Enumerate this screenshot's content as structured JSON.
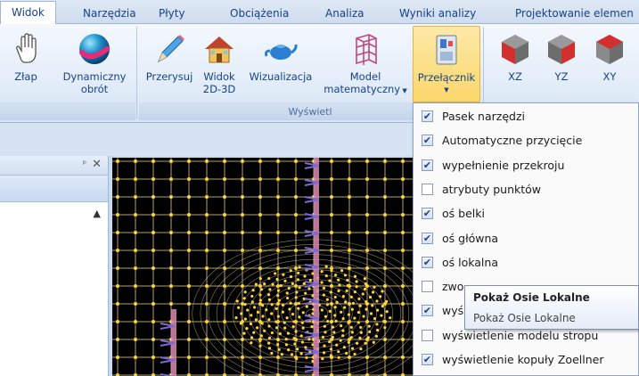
{
  "tabs": [
    {
      "label": "Widok",
      "active": true
    },
    {
      "label": "Narzędzia"
    },
    {
      "label": "Płyty"
    },
    {
      "label": "Obciążenia"
    },
    {
      "label": "Analiza"
    },
    {
      "label": "Wyniki analizy"
    },
    {
      "label": "Projektowanie elemen"
    }
  ],
  "ribbon": {
    "buttons": {
      "grab": "Złap",
      "dynamic_rotate_1": "Dynamiczny",
      "dynamic_rotate_2": "obrót",
      "pan": "Przerysuj",
      "view2d3d_1": "Widok",
      "view2d3d_2": "2D-3D",
      "visualization": "Wizualizacja",
      "model_1": "Model",
      "model_2": "matematyczny",
      "switch": "Przełącznik",
      "xz": "XZ",
      "yz": "YZ",
      "xy": "XY"
    },
    "group_display": "Wyświetl"
  },
  "panel": {
    "pin_glyph": "ᵖ",
    "close_glyph": "✕"
  },
  "menu": {
    "items": [
      {
        "label": "Pasek narzędzi",
        "checked": true
      },
      {
        "label": "Automatyczne przycięcie",
        "checked": true
      },
      {
        "label": "wypełnienie przekroju",
        "checked": true
      },
      {
        "label": "atrybuty punktów",
        "checked": false
      },
      {
        "label": "oś belki",
        "checked": true
      },
      {
        "label": "oś główna",
        "checked": true
      },
      {
        "label": "oś lokalna",
        "checked": true
      },
      {
        "label": "zwo",
        "checked": false
      },
      {
        "label": "wyś",
        "checked": true
      },
      {
        "label": "wyświetlenie modelu stropu",
        "checked": false
      },
      {
        "label": "wyświetlenie kopuły Zoellner",
        "checked": true
      }
    ]
  },
  "tooltip": {
    "title": "Pokaż Osie Lokalne",
    "body": "Pokaż Osie Lokalne"
  },
  "colors": {
    "mesh_background": "#000000",
    "mesh_node": "#ffd23c",
    "mesh_line": "#e8d9a0",
    "beam_pink": "#d88bb0",
    "axis_arrow": "#7b6ad6",
    "pressed_button": "#fbd76a"
  }
}
